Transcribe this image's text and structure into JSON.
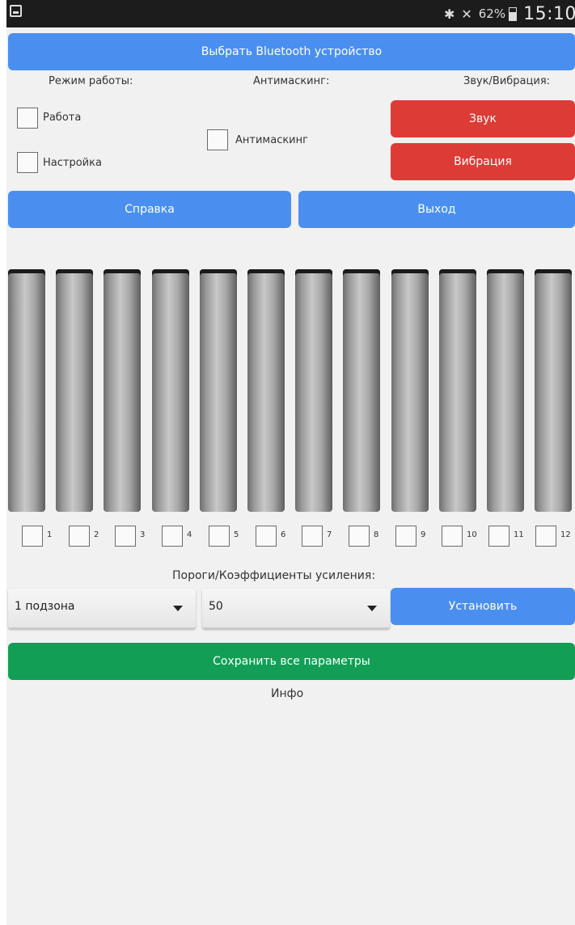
{
  "status_bar": {
    "battery": "62%",
    "time": "15:10"
  },
  "top_button": "Выбрать Bluetooth устройство",
  "sections": {
    "mode_label": "Режим работы:",
    "antimask_label": "Антимаскинг:",
    "sound_label": "Звук/Вибрация:"
  },
  "mode": {
    "work": "Работа",
    "setup": "Настройка"
  },
  "antimask": {
    "label": "Антимаскинг"
  },
  "sound_buttons": {
    "sound": "Звук",
    "vibration": "Вибрация"
  },
  "nav": {
    "help": "Справка",
    "exit": "Выход"
  },
  "zones": {
    "count": 12,
    "labels": [
      "1",
      "2",
      "3",
      "4",
      "5",
      "6",
      "7",
      "8",
      "9",
      "10",
      "11",
      "12"
    ]
  },
  "thresholds": {
    "label": "Пороги/Коэффициенты усиления:",
    "zone_select": "1 подзона",
    "value_select": "50",
    "set_button": "Установить"
  },
  "save_button": "Сохранить все параметры",
  "info_label": "Инфо",
  "colors": {
    "blue": "#4a8ff0",
    "red": "#dd3b36",
    "green": "#129f55"
  }
}
